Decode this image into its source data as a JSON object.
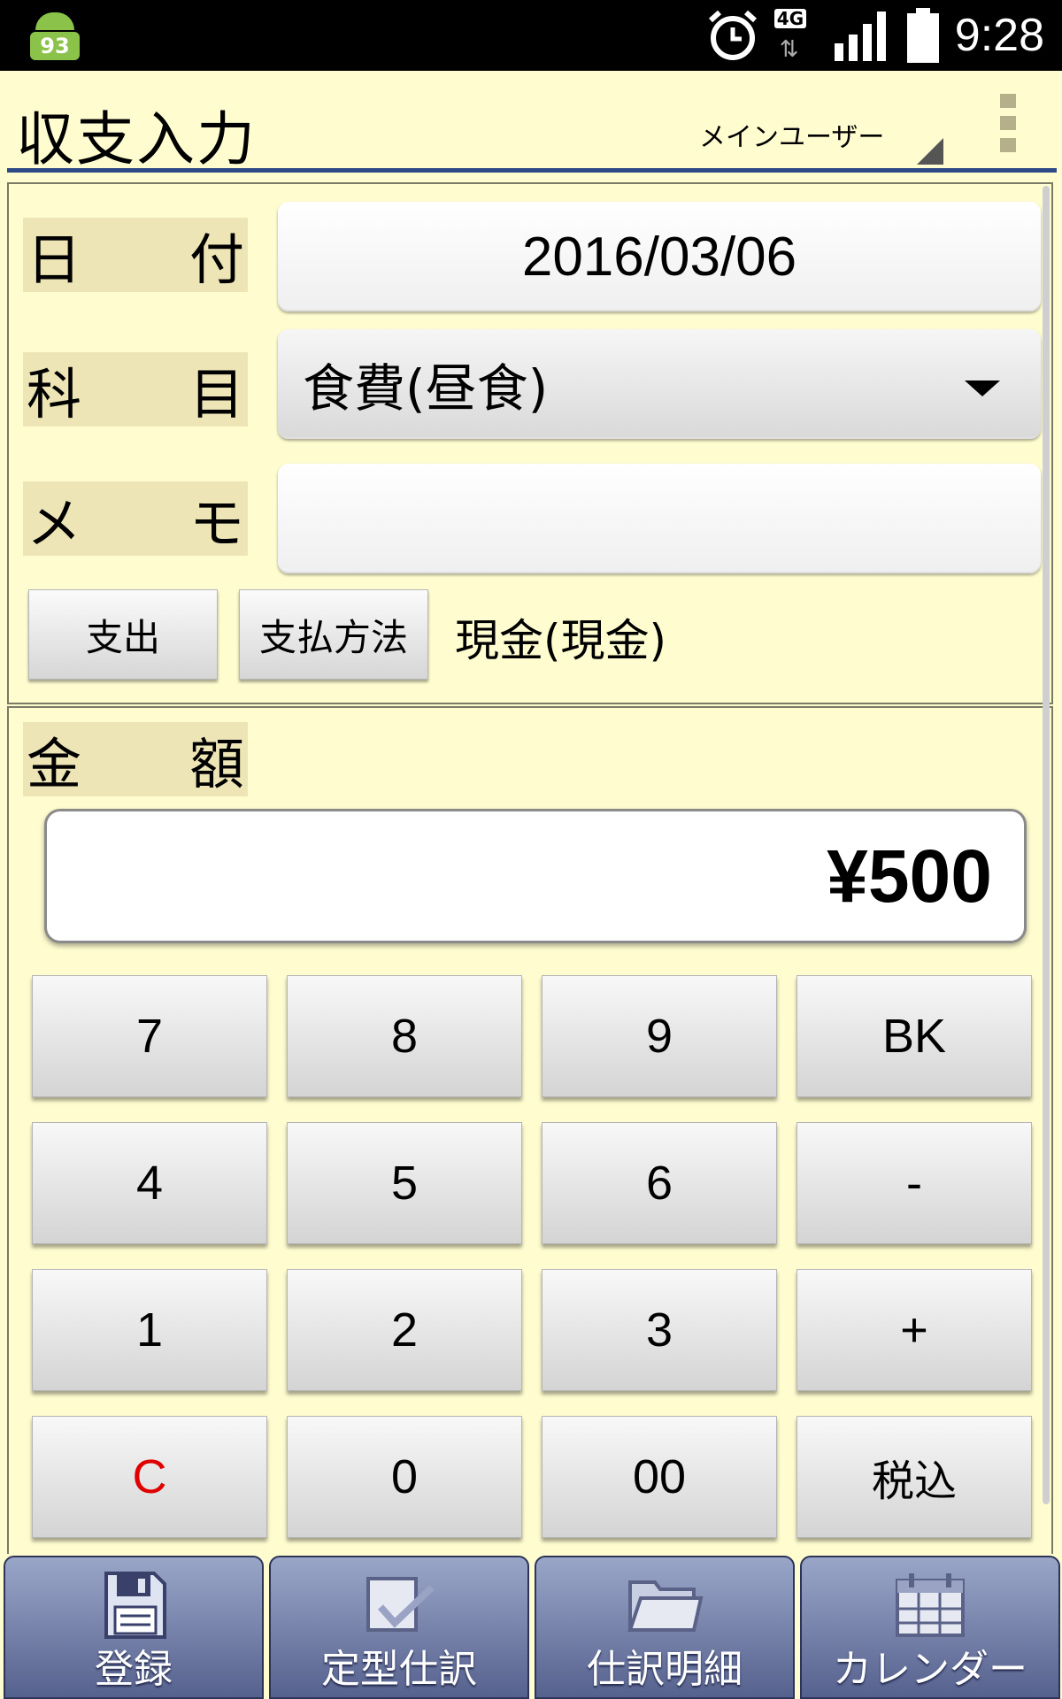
{
  "status_bar": {
    "notification_count": "93",
    "network": "4G",
    "time": "9:28"
  },
  "header": {
    "title": "収支入力",
    "user": "メインユーザー"
  },
  "form": {
    "date_label": [
      "日",
      "付"
    ],
    "date_value": "2016/03/06",
    "subject_label": [
      "科",
      "目"
    ],
    "subject_value": "食費(昼食)",
    "memo_label": [
      "メ",
      "モ"
    ],
    "memo_value": "",
    "type_button": "支出",
    "payment_button": "支払方法",
    "payment_value": "現金(現金)"
  },
  "amount": {
    "label": [
      "金",
      "額"
    ],
    "value": "¥500"
  },
  "keypad": [
    [
      "7",
      "8",
      "9",
      "BK"
    ],
    [
      "4",
      "5",
      "6",
      "-"
    ],
    [
      "1",
      "2",
      "3",
      "+"
    ],
    [
      "C",
      "0",
      "00",
      "税込"
    ]
  ],
  "nav": [
    {
      "label": "登録",
      "icon": "save-icon"
    },
    {
      "label": "定型仕訳",
      "icon": "checkbox-icon"
    },
    {
      "label": "仕訳明細",
      "icon": "folder-icon"
    },
    {
      "label": "カレンダー",
      "icon": "calendar-icon"
    }
  ],
  "colors": {
    "background": "#fffdd0",
    "label_bg": "#ede5b6",
    "accent": "#2d4a86",
    "clear_key": "#e00000"
  }
}
